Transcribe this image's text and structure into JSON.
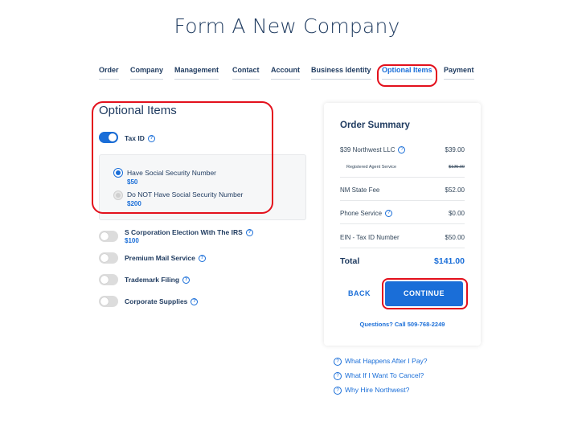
{
  "page": {
    "title": "Form A New Company"
  },
  "tabs": [
    {
      "label": "Order"
    },
    {
      "label": "Company"
    },
    {
      "label": "Management"
    },
    {
      "label": "Contact"
    },
    {
      "label": "Account"
    },
    {
      "label": "Business Identity"
    },
    {
      "label": "Optional Items",
      "active": true
    },
    {
      "label": "Payment"
    }
  ],
  "optional": {
    "section_title": "Optional Items",
    "tax_id": {
      "label": "Tax ID",
      "enabled": true,
      "choices": [
        {
          "label": "Have Social Security Number",
          "price": "$50",
          "selected": true
        },
        {
          "label": "Do NOT Have Social Security Number",
          "price": "$200",
          "selected": false
        }
      ]
    },
    "items": [
      {
        "label": "S Corporation Election With The IRS",
        "price": "$100",
        "enabled": false
      },
      {
        "label": "Premium Mail Service",
        "enabled": false
      },
      {
        "label": "Trademark Filing",
        "enabled": false
      },
      {
        "label": "Corporate Supplies",
        "enabled": false
      }
    ]
  },
  "summary": {
    "title": "Order Summary",
    "lines": [
      {
        "label": "$39 Northwest LLC",
        "amount": "$39.00"
      },
      {
        "label": "Registered Agent Service",
        "amount": "$125.00",
        "strikethrough": true
      },
      {
        "label": "NM State Fee",
        "amount": "$52.00"
      },
      {
        "label": "Phone Service",
        "amount": "$0.00"
      },
      {
        "label": "EIN - Tax ID Number",
        "amount": "$50.00"
      }
    ],
    "total_label": "Total",
    "total_amount": "$141.00",
    "back_label": "BACK",
    "continue_label": "CONTINUE",
    "questions": "Questions? Call 509-768-2249"
  },
  "faq": [
    {
      "label": "What Happens After I Pay?"
    },
    {
      "label": "What If I Want To Cancel?"
    },
    {
      "label": "Why Hire Northwest?"
    }
  ],
  "colors": {
    "accent": "#1a6ed8",
    "highlight": "#e3101c",
    "heading": "#1e3a5f"
  }
}
